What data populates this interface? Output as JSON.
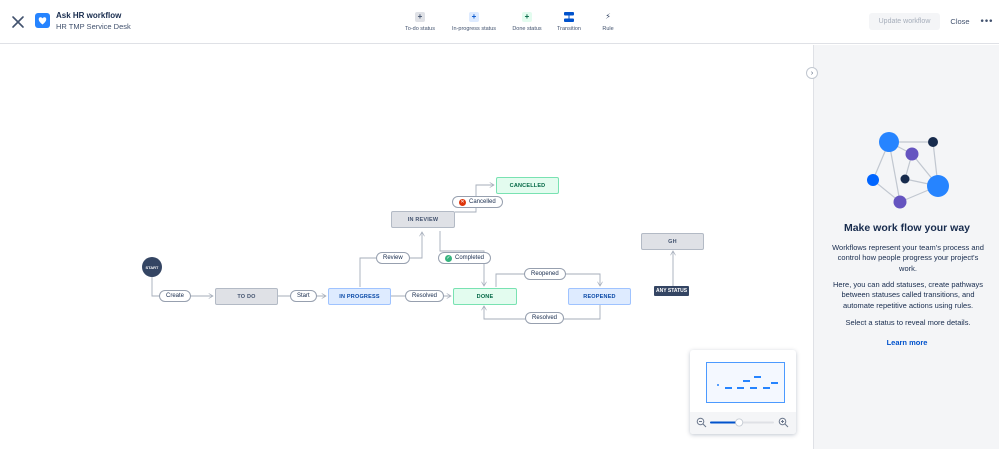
{
  "header": {
    "title": "Ask HR workflow",
    "subtitle": "HR TMP Service Desk",
    "tools": [
      {
        "label": "To-do status",
        "glyph": "+"
      },
      {
        "label": "In-progress status",
        "glyph": "+"
      },
      {
        "label": "Done status",
        "glyph": "+"
      },
      {
        "label": "Transition",
        "glyph": ""
      },
      {
        "label": "Rule",
        "glyph": "⚡"
      }
    ],
    "update_label": "Update workflow",
    "close_label": "Close",
    "more_glyph": "•••"
  },
  "workflow": {
    "start_label": "START",
    "any_status_label": "ANY STATUS",
    "statuses": {
      "todo": "TO DO",
      "in_progress": "IN PROGRESS",
      "in_review": "IN REVIEW",
      "cancelled": "CANCELLED",
      "done": "DONE",
      "reopened": "REOPENED",
      "gh": "GH"
    },
    "transitions": {
      "create": "Create",
      "start": "Start",
      "review": "Review",
      "cancelled": "Cancelled",
      "completed": "Completed",
      "resolved_1": "Resolved",
      "reopened": "Reopened",
      "resolved_2": "Resolved"
    }
  },
  "minimap": {
    "zoom_level": 0.45
  },
  "panel": {
    "heading": "Make work flow your way",
    "para1": "Workflows represent your team's process and control how people progress your project's work.",
    "para2": "Here, you can add statuses, create pathways between statuses called transitions, and automate repetitive actions using rules.",
    "para3": "Select a status to reveal more details.",
    "link": "Learn more"
  },
  "colors": {
    "accent": "#0052cc",
    "todo": "#dfe1e6",
    "in_progress": "#deebff",
    "done": "#e3fcef",
    "cancelled_icon": "#de350b",
    "completed_icon": "#36b37e"
  }
}
